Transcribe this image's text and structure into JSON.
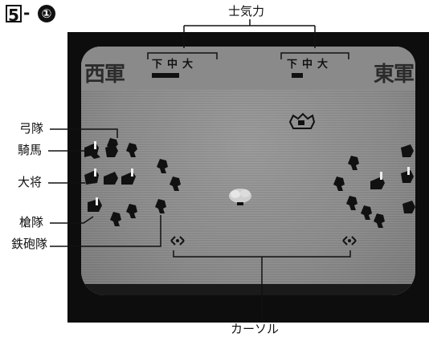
{
  "figure": {
    "number": "5",
    "separator": "-",
    "sub": "①"
  },
  "callouts": {
    "morale": "士気力",
    "archers": "弓隊",
    "cavalry": "騎馬",
    "general": "大将",
    "spearmen": "槍隊",
    "gunners": "鉄砲隊",
    "cursor": "カーソル"
  },
  "screen": {
    "west_army": "西軍",
    "east_army": "東軍",
    "morale_west": [
      "下",
      "中",
      "大"
    ],
    "morale_east": [
      "下",
      "中",
      "大"
    ]
  },
  "colors": {
    "tv_frame": "#0d0d0d",
    "screen": "#8c8c8c",
    "units": "#111111"
  }
}
